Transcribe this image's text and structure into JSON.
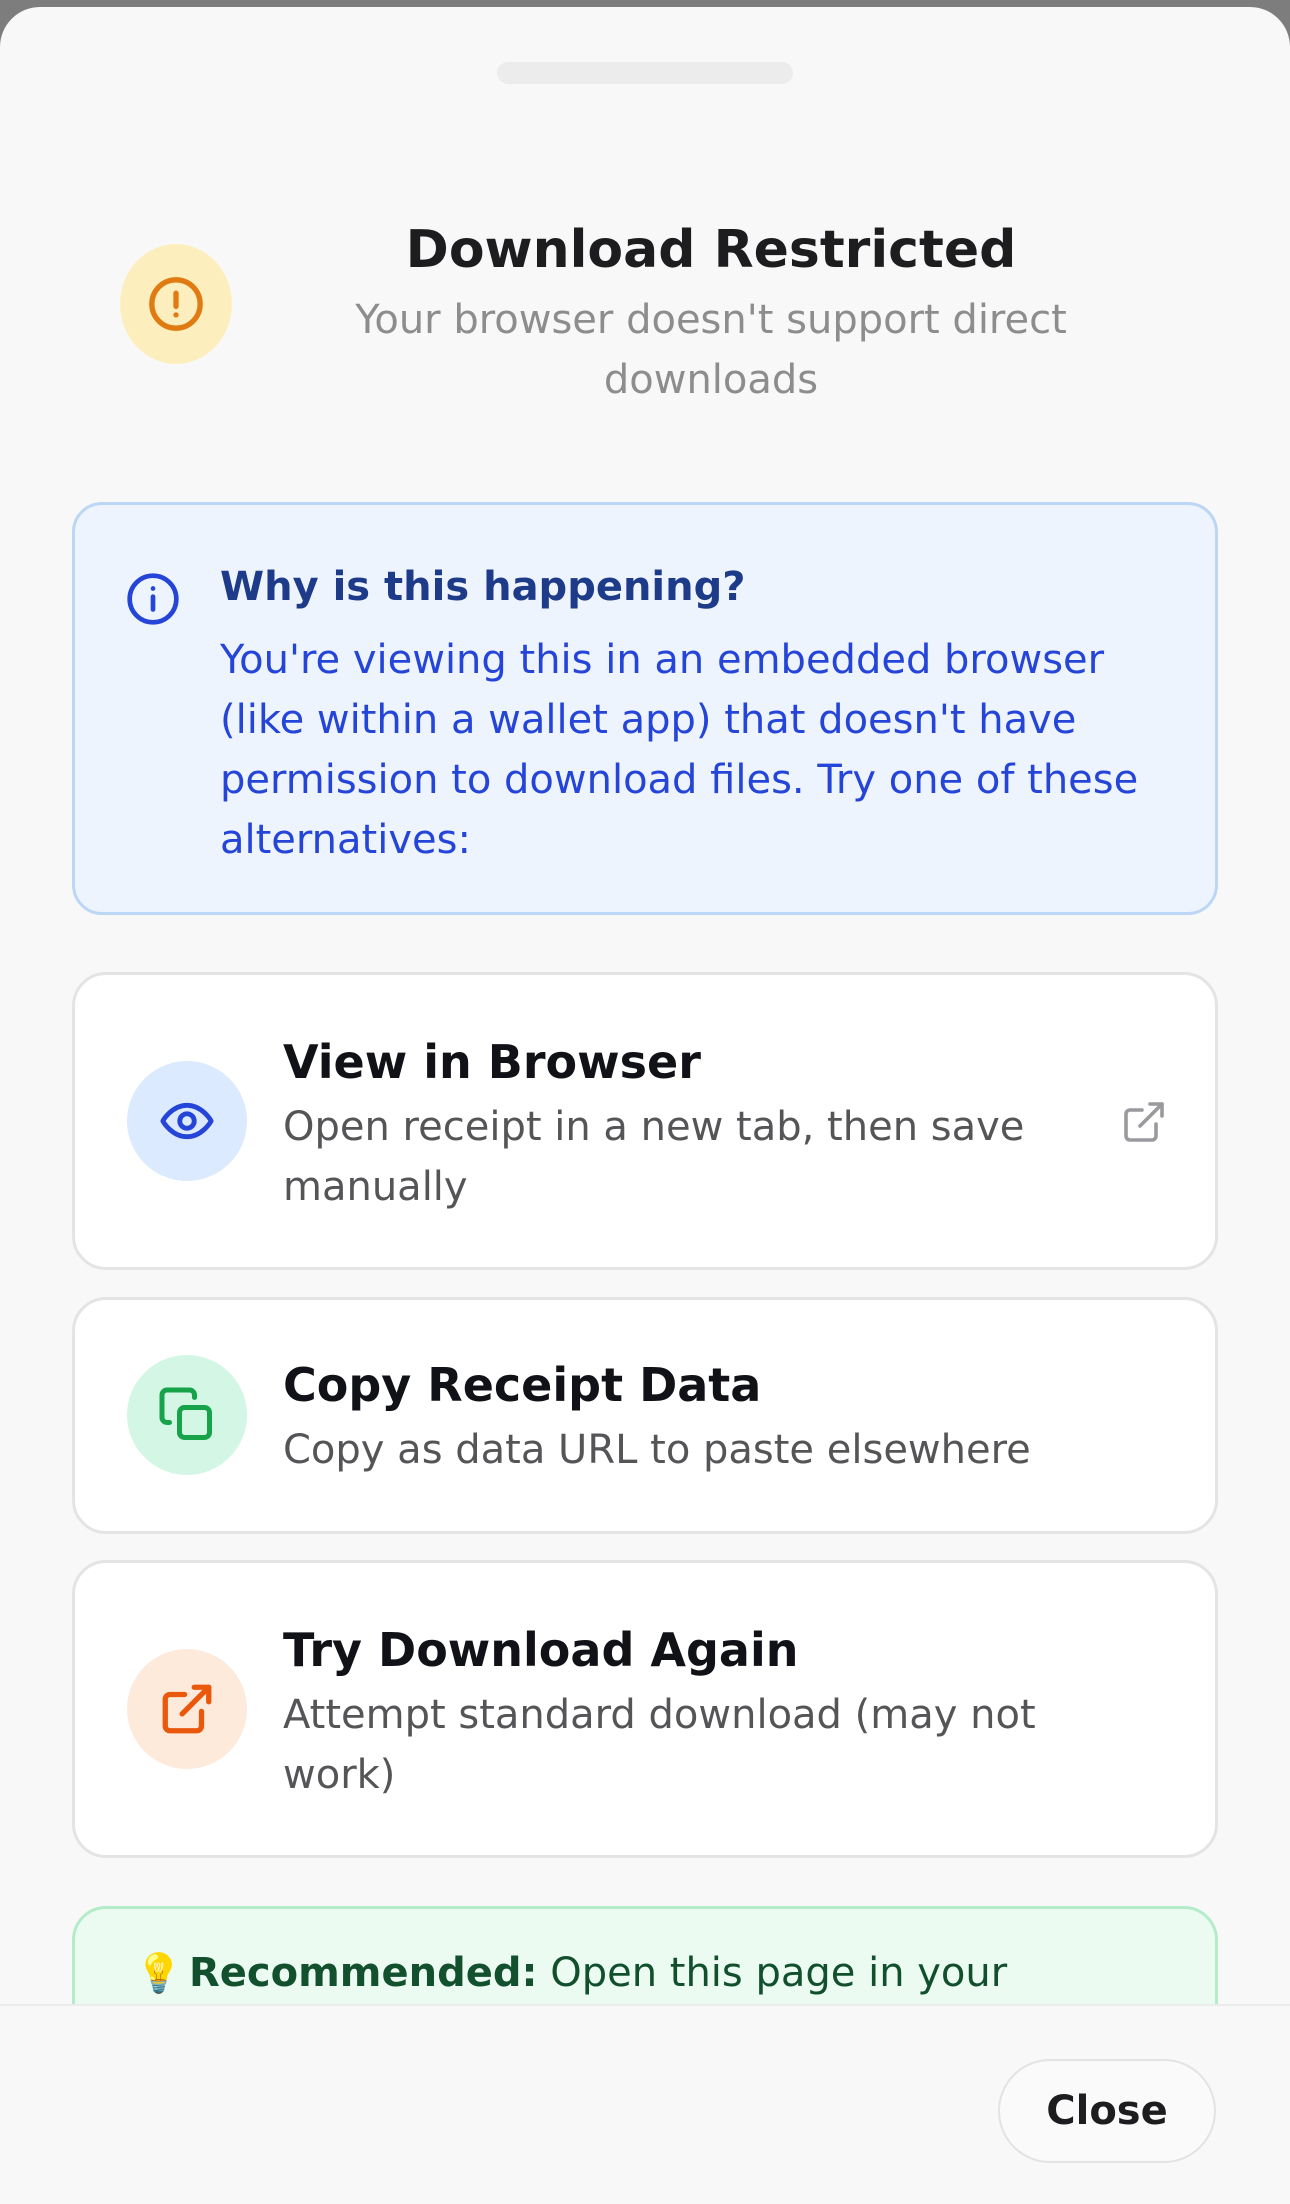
{
  "dialog": {
    "title": "Download Restricted",
    "subtitle": "Your browser doesn't support direct downloads",
    "header_icon": "alert-circle-icon"
  },
  "info": {
    "icon": "info-circle-icon",
    "title": "Why is this happening?",
    "body": "You're viewing this in an embedded browser (like within a wallet app) that doesn't have permission to download files. Try one of these alternatives:"
  },
  "options": [
    {
      "icon": "eye-icon",
      "title": "View in Browser",
      "description": "Open receipt in a new tab, then save manually",
      "trailing_icon": "external-link-icon"
    },
    {
      "icon": "copy-icon",
      "title": "Copy Receipt Data",
      "description": "Copy as data URL to paste elsewhere"
    },
    {
      "icon": "external-link-icon",
      "title": "Try Download Again",
      "description": "Attempt standard download (may not work)"
    }
  ],
  "recommendation": {
    "icon": "lightbulb-icon",
    "label": "Recommended:",
    "text": "Open this page in your"
  },
  "footer": {
    "close_label": "Close"
  },
  "colors": {
    "warning": "#e07b14",
    "info": "#2545d8",
    "success": "#16a34a",
    "orange_accent": "#ea580c"
  }
}
